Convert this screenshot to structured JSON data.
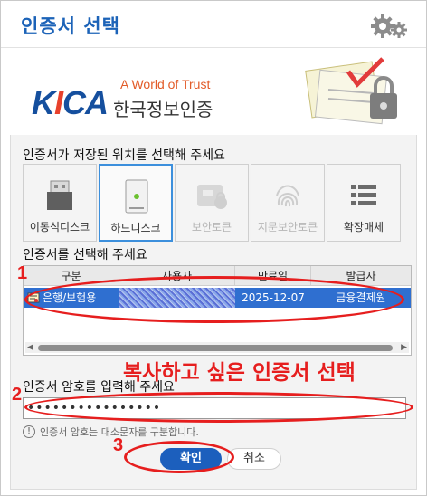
{
  "window": {
    "title": "인증서 선택"
  },
  "header": {
    "logo_text": "KICA",
    "tagline": "A World of Trust",
    "org_name": "한국정보인증"
  },
  "storage": {
    "label": "인증서가 저장된 위치를 선택해 주세요",
    "options": [
      {
        "label": "이동식디스크",
        "icon": "usb-drive-icon",
        "state": "enabled"
      },
      {
        "label": "하드디스크",
        "icon": "hard-disk-icon",
        "state": "selected"
      },
      {
        "label": "보안토큰",
        "icon": "security-token-icon",
        "state": "disabled"
      },
      {
        "label": "지문보안토큰",
        "icon": "fingerprint-icon",
        "state": "disabled"
      },
      {
        "label": "확장매체",
        "icon": "list-icon",
        "state": "enabled"
      }
    ]
  },
  "certificates": {
    "label": "인증서를 선택해 주세요",
    "columns": [
      "구분",
      "사용자",
      "만료일",
      "발급자"
    ],
    "rows": [
      {
        "type": "은행/보험용",
        "user": "",
        "expiry": "2025-12-07",
        "issuer": "금융결제원"
      }
    ]
  },
  "password": {
    "label": "인증서 암호를 입력해 주세요",
    "value": "••••••••••••••••",
    "notice": "인증서 암호는 대소문자를 구분합니다."
  },
  "buttons": {
    "ok": "확인",
    "cancel": "취소"
  },
  "annotations": {
    "step1": "1",
    "step2": "2",
    "step3": "3",
    "note": "복사하고 싶은 인증서 선택",
    "color": "#e61e1e"
  },
  "colors": {
    "accent": "#1c63b8",
    "selection": "#2f6fd0"
  }
}
